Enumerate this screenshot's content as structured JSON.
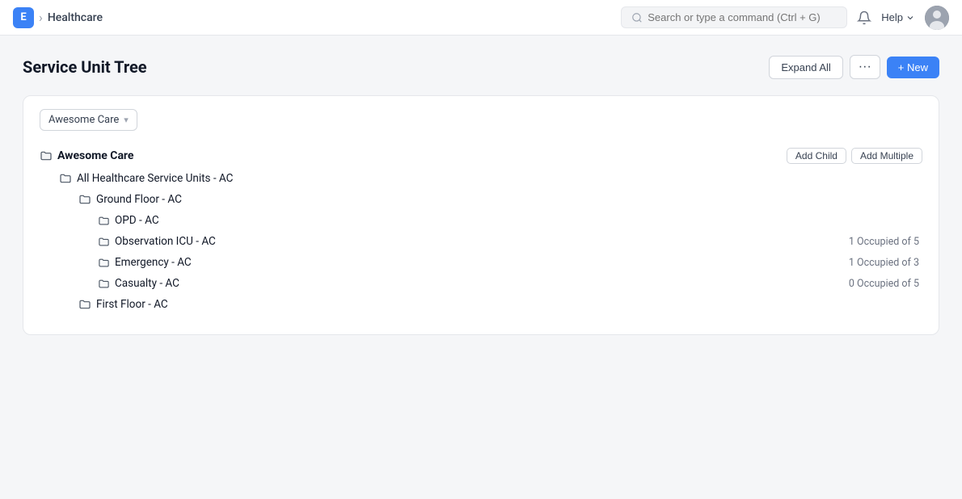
{
  "nav": {
    "logo_label": "E",
    "breadcrumb_sep": "›",
    "breadcrumb": "Healthcare",
    "search_placeholder": "Search or type a command (Ctrl + G)",
    "help_label": "Help",
    "bell_icon": "🔔"
  },
  "page": {
    "title": "Service Unit Tree",
    "expand_all_label": "Expand All",
    "more_label": "···",
    "new_label": "+ New"
  },
  "dropdown": {
    "label": "Awesome Care",
    "caret": "⊙"
  },
  "tree": {
    "root": {
      "label": "Awesome Care",
      "add_child": "Add Child",
      "add_multiple": "Add Multiple"
    },
    "nodes": [
      {
        "id": "n1",
        "indent": 1,
        "label": "All Healthcare Service Units - AC",
        "folder_size": "lg",
        "stat": ""
      },
      {
        "id": "n2",
        "indent": 2,
        "label": "Ground Floor - AC",
        "folder_size": "lg",
        "stat": ""
      },
      {
        "id": "n3",
        "indent": 3,
        "label": "OPD - AC",
        "folder_size": "sm",
        "stat": ""
      },
      {
        "id": "n4",
        "indent": 3,
        "label": "Observation ICU - AC",
        "folder_size": "sm",
        "stat": "1 Occupied of 5"
      },
      {
        "id": "n5",
        "indent": 3,
        "label": "Emergency - AC",
        "folder_size": "sm",
        "stat": "1 Occupied of 3"
      },
      {
        "id": "n6",
        "indent": 3,
        "label": "Casualty - AC",
        "folder_size": "sm",
        "stat": "0 Occupied of 5"
      },
      {
        "id": "n7",
        "indent": 2,
        "label": "First Floor - AC",
        "folder_size": "lg",
        "stat": ""
      }
    ]
  }
}
